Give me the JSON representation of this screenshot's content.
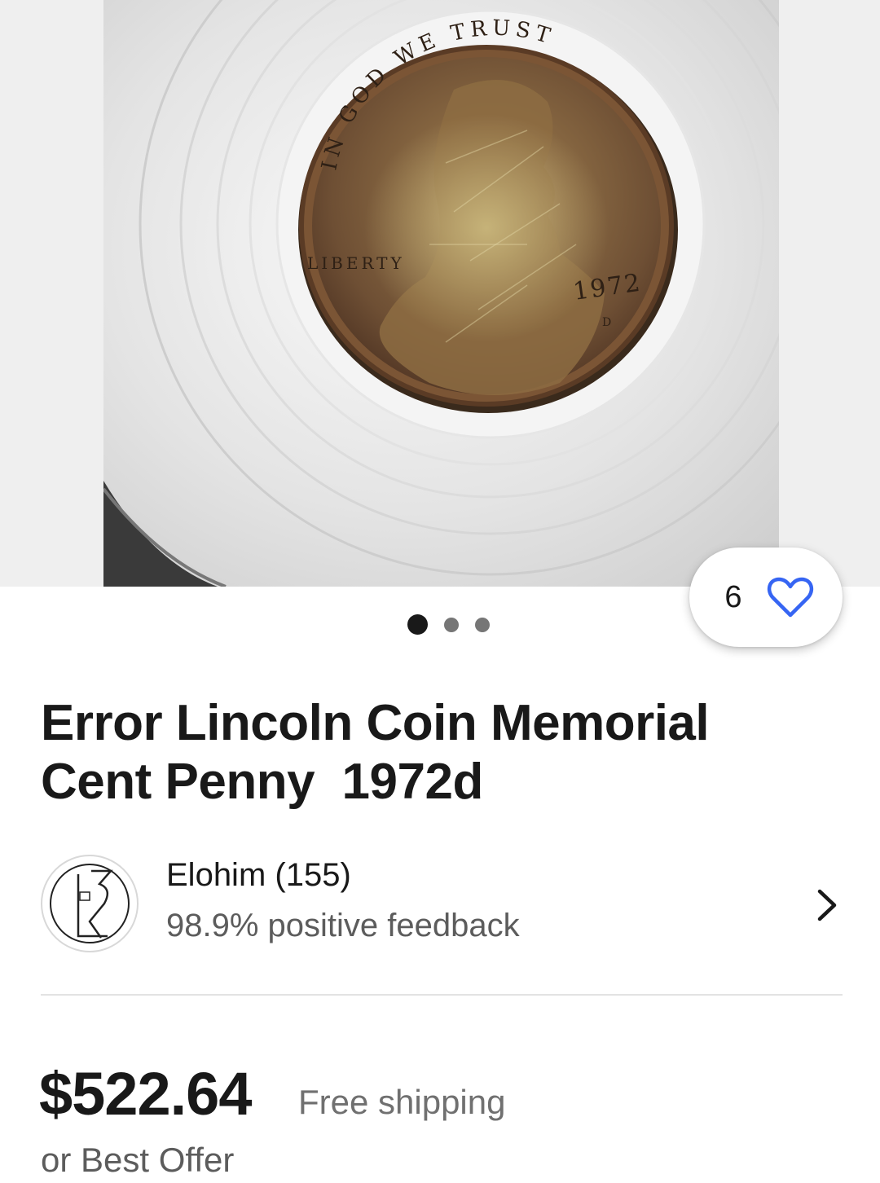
{
  "listing": {
    "title": "Error Lincoln Coin Memorial Cent Penny  1972d",
    "image_count": 3,
    "active_image_index": 0,
    "coin_inscriptions": {
      "motto": "IN GOD WE TRUST",
      "liberty": "LIBERTY",
      "year": "1972",
      "mint_mark": "D"
    }
  },
  "watch": {
    "count": "6",
    "icon": "heart-icon"
  },
  "seller": {
    "name": "Elohim (155)",
    "feedback": "98.9% positive feedback",
    "chevron_icon": "chevron-right-icon"
  },
  "price": {
    "amount": "$522.64",
    "shipping": "Free shipping",
    "offer": "or Best Offer"
  },
  "colors": {
    "text_primary": "#191919",
    "text_secondary": "#5c5c5c",
    "accent_heart": "#3665f3",
    "dot_active": "#191919",
    "dot_inactive": "#767676"
  }
}
